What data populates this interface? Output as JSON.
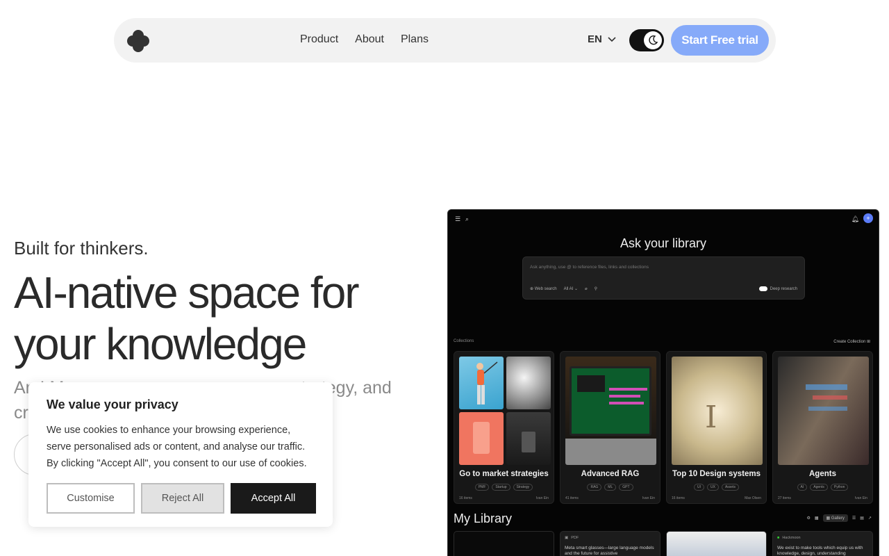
{
  "nav": {
    "links": [
      "Product",
      "About",
      "Plans"
    ],
    "language": "EN",
    "cta_label": "Start Free trial"
  },
  "hero": {
    "tagline": "Built for thinkers.",
    "headline": "AI-native space for your knowledge",
    "subhead_visible_fragment_1": "An",
    "subhead_visible_fragment_2": "I M",
    "subhead_visible_fragment_3": ", strategy, and",
    "subhead_visible_fragment_4": "cr"
  },
  "cookie": {
    "title": "We value your privacy",
    "body": "We use cookies to enhance your browsing experience, serve personalised ads or content, and analyse our traffic. By clicking \"Accept All\", you consent to our use of cookies.",
    "customise_label": "Customise",
    "reject_label": "Reject All",
    "accept_label": "Accept All"
  },
  "app": {
    "ask_title": "Ask your library",
    "ask_placeholder": "Ask anything, use @ to reference files, links and collections",
    "web_search": "Web search",
    "model": "All AI",
    "deep_research": "Deep research",
    "collections_label": "Collections",
    "create_collection": "Create Collection",
    "cards": [
      {
        "title": "Go to market strategies",
        "tags": [
          "PMF",
          "Startup",
          "Strategy"
        ],
        "items": "16 items",
        "owner": "Ivan Ein"
      },
      {
        "title": "Advanced RAG",
        "tags": [
          "RAG",
          "ML",
          "GPT"
        ],
        "items": "41 items",
        "owner": "Ivan Ein"
      },
      {
        "title": "Top 10 Design systems",
        "tags": [
          "UI",
          "UX",
          "Assets"
        ],
        "items": "16 items",
        "owner": "Max Olsen"
      },
      {
        "title": "Agents",
        "tags": [
          "AI",
          "Agents",
          "Python"
        ],
        "items": "27 items",
        "owner": "Ivan Ein"
      }
    ],
    "my_library": "My Library",
    "gallery": "Gallery",
    "lib_items": [
      {
        "hdr": "",
        "text": ""
      },
      {
        "hdr": "PDF",
        "text": "Meta smart glasses—large language models and the future for assistive"
      },
      {
        "hdr": "",
        "text": ""
      },
      {
        "hdr": "Hackmoon",
        "text": "We exist to make tools which equip us with knowledge, design, understanding"
      }
    ]
  },
  "colors": {
    "cta": "#86aaf9",
    "accent_dark": "#1a1a1a"
  }
}
